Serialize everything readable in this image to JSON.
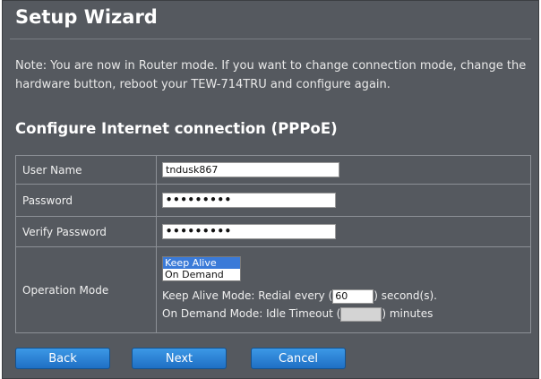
{
  "header": {
    "title": "Setup Wizard"
  },
  "note": "Note: You are now in Router mode. If you want to change connection mode, change the hardware button, reboot your TEW-714TRU and configure again.",
  "section_title": "Configure Internet connection (PPPoE)",
  "form": {
    "user_name": {
      "label": "User Name",
      "value": "tndusk867"
    },
    "password": {
      "label": "Password",
      "value": "•••••••••"
    },
    "verify_password": {
      "label": "Verify Password",
      "value": "•••••••••"
    },
    "operation_mode": {
      "label": "Operation Mode",
      "options": [
        "Keep Alive",
        "On Demand"
      ],
      "selected": "Keep Alive",
      "keep_alive_prefix": "Keep Alive Mode: Redial every (",
      "keep_alive_value": "60",
      "keep_alive_suffix": ") second(s).",
      "on_demand_prefix": "On Demand Mode: Idle Timeout (",
      "on_demand_value": "",
      "on_demand_suffix": ") minutes"
    }
  },
  "buttons": {
    "back": "Back",
    "next": "Next",
    "cancel": "Cancel"
  }
}
